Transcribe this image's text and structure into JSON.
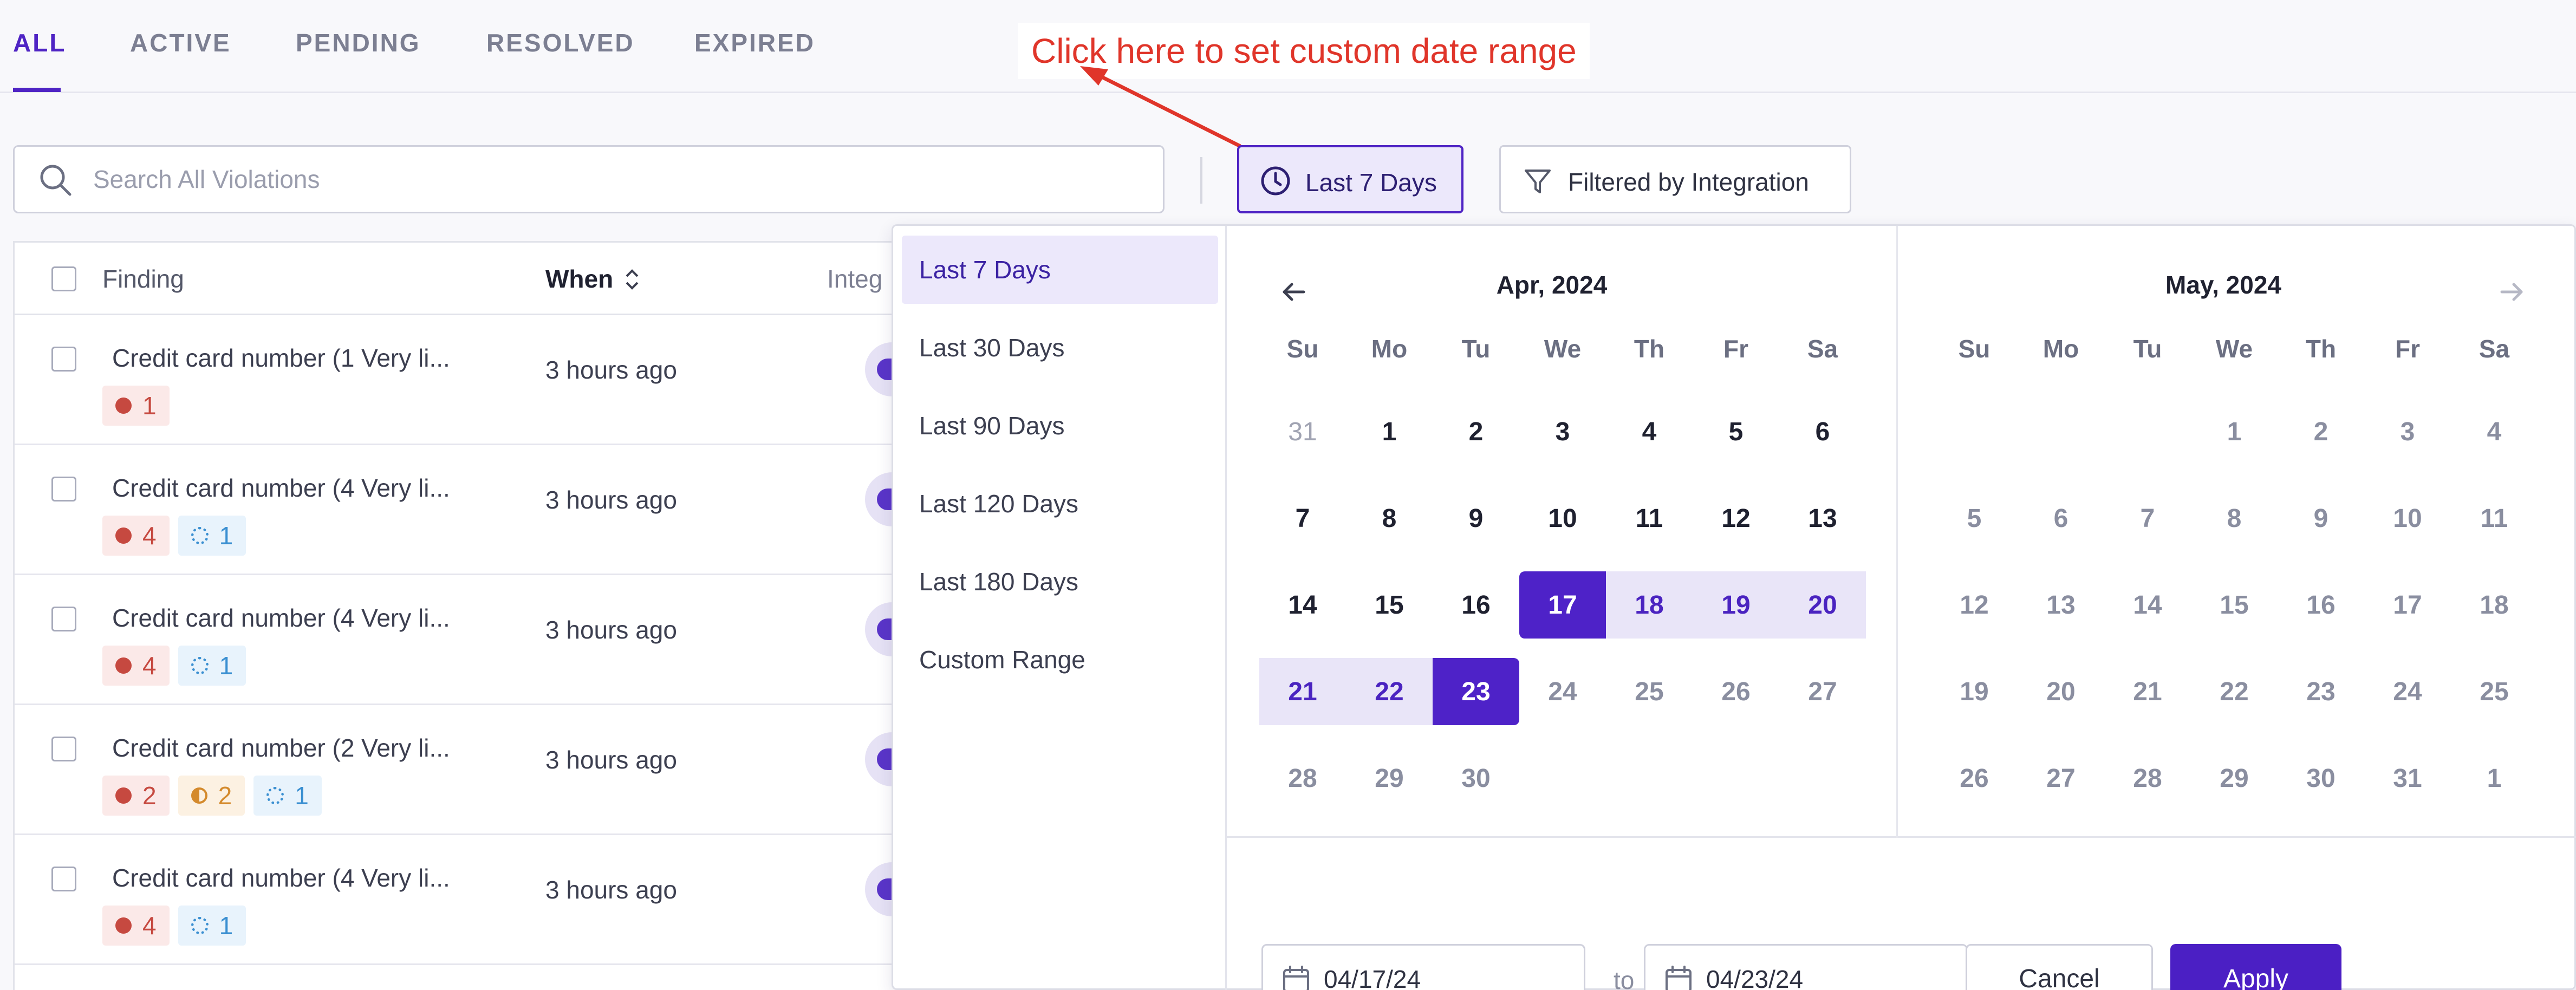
{
  "tabs": [
    {
      "label": "ALL",
      "active": true
    },
    {
      "label": "ACTIVE",
      "active": false
    },
    {
      "label": "PENDING",
      "active": false
    },
    {
      "label": "RESOLVED",
      "active": false
    },
    {
      "label": "EXPIRED",
      "active": false
    }
  ],
  "annotation": {
    "text": "Click here to set custom date range",
    "color": "#e0352a"
  },
  "search": {
    "placeholder": "Search All Violations",
    "value": ""
  },
  "toolbar": {
    "date_range_label": "Last 7 Days",
    "filter_label": "Filtered by Integration"
  },
  "table": {
    "columns": {
      "finding": "Finding",
      "when": "When",
      "integration": "Integ"
    },
    "rows": [
      {
        "finding": "Credit card number (1 Very li...",
        "when": "3 hours ago",
        "badges": [
          {
            "type": "red",
            "count": "1"
          }
        ]
      },
      {
        "finding": "Credit card number (4 Very li...",
        "when": "3 hours ago",
        "badges": [
          {
            "type": "red",
            "count": "4"
          },
          {
            "type": "blue",
            "count": "1"
          }
        ]
      },
      {
        "finding": "Credit card number (4 Very li...",
        "when": "3 hours ago",
        "badges": [
          {
            "type": "red",
            "count": "4"
          },
          {
            "type": "blue",
            "count": "1"
          }
        ]
      },
      {
        "finding": "Credit card number (2 Very li...",
        "when": "3 hours ago",
        "badges": [
          {
            "type": "red",
            "count": "2"
          },
          {
            "type": "orange",
            "count": "2"
          },
          {
            "type": "blue",
            "count": "1"
          }
        ]
      },
      {
        "finding": "Credit card number (4 Very li...",
        "when": "3 hours ago",
        "badges": [
          {
            "type": "red",
            "count": "4"
          },
          {
            "type": "blue",
            "count": "1"
          }
        ]
      }
    ]
  },
  "presets": [
    {
      "label": "Last 7 Days",
      "active": true
    },
    {
      "label": "Last 30 Days",
      "active": false
    },
    {
      "label": "Last 90 Days",
      "active": false
    },
    {
      "label": "Last 120 Days",
      "active": false
    },
    {
      "label": "Last 180 Days",
      "active": false
    },
    {
      "label": "Custom Range",
      "active": false
    }
  ],
  "calendar": {
    "weekdays": [
      "Su",
      "Mo",
      "Tu",
      "We",
      "Th",
      "Fr",
      "Sa"
    ],
    "left": {
      "title": "Apr, 2024",
      "weeks": [
        [
          "31",
          "1",
          "2",
          "3",
          "4",
          "5",
          "6"
        ],
        [
          "7",
          "8",
          "9",
          "10",
          "11",
          "12",
          "13"
        ],
        [
          "14",
          "15",
          "16",
          "17",
          "18",
          "19",
          "20"
        ],
        [
          "21",
          "22",
          "23",
          "24",
          "25",
          "26",
          "27"
        ],
        [
          "28",
          "29",
          "30",
          "",
          "",
          "",
          ""
        ]
      ]
    },
    "right": {
      "title": "May, 2024",
      "weeks": [
        [
          "",
          "",
          "",
          "1",
          "2",
          "3",
          "4"
        ],
        [
          "5",
          "6",
          "7",
          "8",
          "9",
          "10",
          "11"
        ],
        [
          "12",
          "13",
          "14",
          "15",
          "16",
          "17",
          "18"
        ],
        [
          "19",
          "20",
          "21",
          "22",
          "23",
          "24",
          "25"
        ],
        [
          "26",
          "27",
          "28",
          "29",
          "30",
          "31",
          "1"
        ]
      ]
    },
    "range_start": "17",
    "range_end": "23"
  },
  "footer": {
    "start_date": "04/17/24",
    "to_label": "to",
    "end_date": "04/23/24",
    "cancel_label": "Cancel",
    "apply_label": "Apply"
  },
  "colors": {
    "accent": "#4f24c4",
    "range": "#e9e5f8"
  }
}
